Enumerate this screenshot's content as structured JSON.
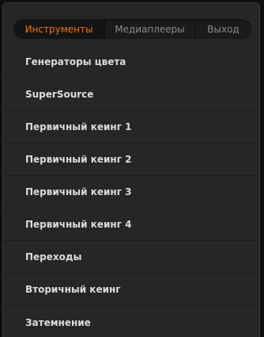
{
  "tabs": [
    {
      "label": "Инструменты",
      "active": true
    },
    {
      "label": "Медиаплееры",
      "active": false
    },
    {
      "label": "Выход",
      "active": false
    }
  ],
  "menu_items": [
    {
      "label": "Генераторы цвета"
    },
    {
      "label": "SuperSource"
    },
    {
      "label": "Первичный кеинг 1"
    },
    {
      "label": "Первичный кеинг 2"
    },
    {
      "label": "Первичный кеинг 3"
    },
    {
      "label": "Первичный кеинг 4"
    },
    {
      "label": "Переходы"
    },
    {
      "label": "Вторичный кеинг"
    },
    {
      "label": "Затемнение"
    }
  ],
  "colors": {
    "accent": "#e8731c",
    "panel": "#262626",
    "text": "#dcdcdc"
  }
}
